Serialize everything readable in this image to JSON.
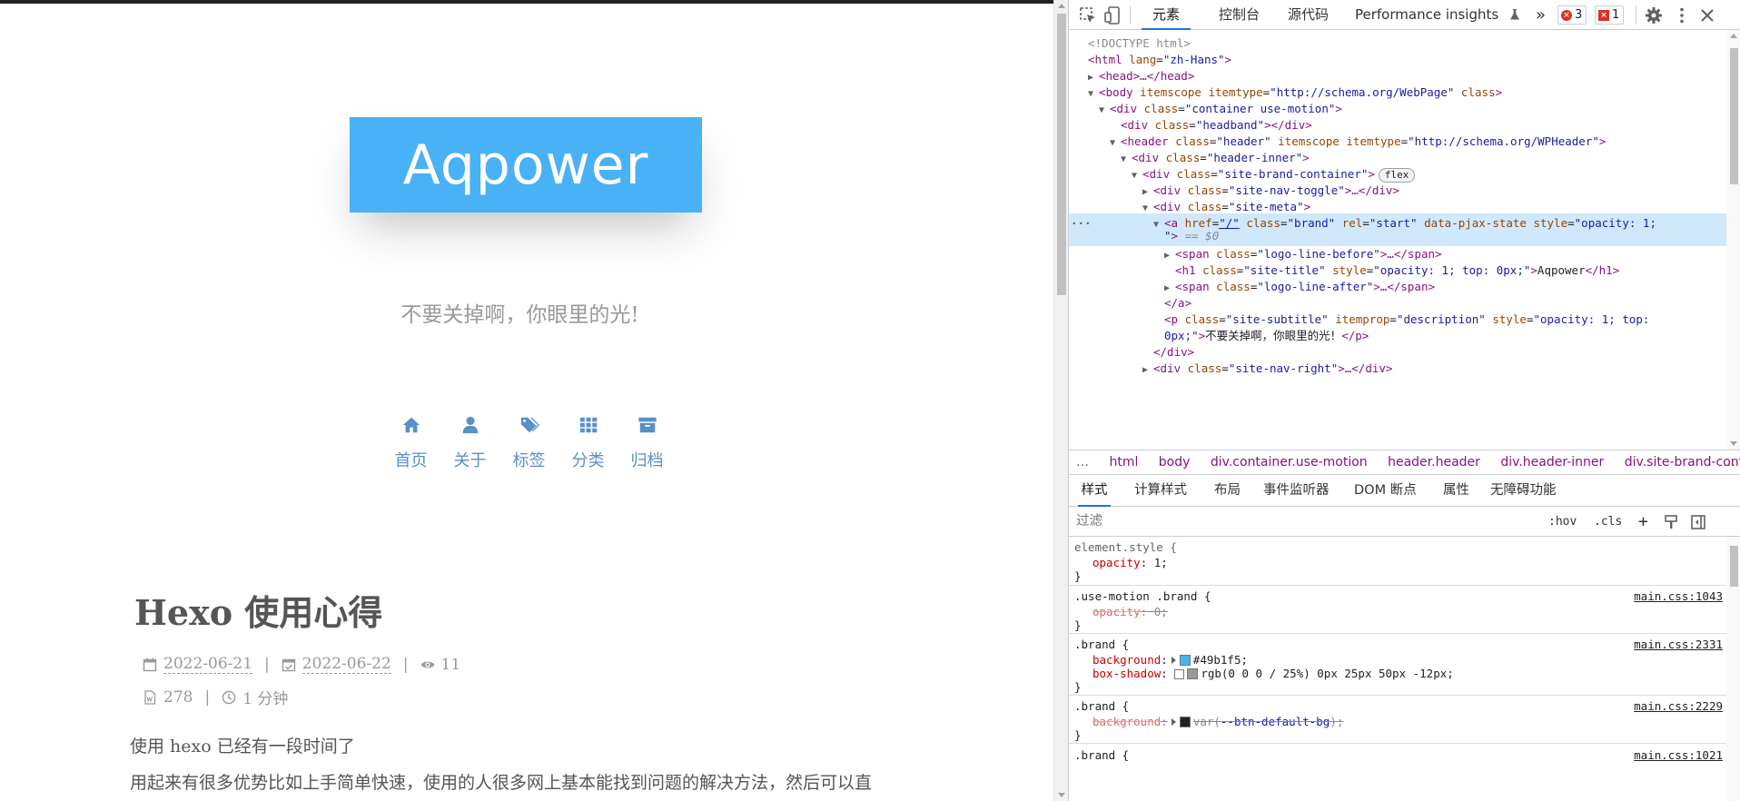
{
  "page": {
    "site_title": "Aqpower",
    "site_subtitle": "不要关掉啊，你眼里的光!",
    "nav": [
      {
        "icon": "home-icon",
        "label": "首页"
      },
      {
        "icon": "user-icon",
        "label": "关于"
      },
      {
        "icon": "tags-icon",
        "label": "标签"
      },
      {
        "icon": "grid-icon",
        "label": "分类"
      },
      {
        "icon": "archive-icon",
        "label": "归档"
      }
    ],
    "post": {
      "title": "Hexo 使用心得",
      "created": "2022-06-21",
      "updated": "2022-06-22",
      "views": "11",
      "words": "278",
      "read_time": "1 分钟",
      "separator": "|",
      "paragraph1": "使用 hexo 已经有一段时间了",
      "paragraph2": "用起来有很多优势比如上手简单快速，使用的人很多网上基本能找到问题的解决方法，然后可以直"
    },
    "colors": {
      "brand": "#49b1f5",
      "nav": "#5891c5"
    }
  },
  "devtools": {
    "tabs": [
      "元素",
      "控制台",
      "源代码",
      "Performance insights"
    ],
    "more": "»",
    "error_count": "3",
    "issue_count": "1",
    "dom": {
      "l1": "<!DOCTYPE html>",
      "l2_tag": "<html",
      "l2_attr": "lang",
      "l2_val": "\"zh-Hans\"",
      "l2_end": ">",
      "l3": "<head>…</head>",
      "l4_tag": "<body",
      "l4_a1": "itemscope",
      "l4_a2": "itemtype",
      "l4_v2": "\"http://schema.org/WebPage\"",
      "l4_a3": "class",
      "l4_end": ">",
      "l5_tag": "<div",
      "l5_a": "class",
      "l5_v": "\"container use-motion\"",
      "l5_end": ">",
      "l6_tag": "<div",
      "l6_a": "class",
      "l6_v": "\"headband\"",
      "l6_end": "></div>",
      "l7_tag": "<header",
      "l7_a1": "class",
      "l7_v1": "\"header\"",
      "l7_a2": "itemscope",
      "l7_a3": "itemtype",
      "l7_v3": "\"http://schema.org/WPHeader\"",
      "l7_end": ">",
      "l8_tag": "<div",
      "l8_a": "class",
      "l8_v": "\"header-inner\"",
      "l8_end": ">",
      "l9_tag": "<div",
      "l9_a": "class",
      "l9_v": "\"site-brand-container\"",
      "l9_end": ">",
      "l9_badge": "flex",
      "l10_tag": "<div",
      "l10_a": "class",
      "l10_v": "\"site-nav-toggle\"",
      "l10_end": ">…</div>",
      "l11_tag": "<div",
      "l11_a": "class",
      "l11_v": "\"site-meta\"",
      "l11_end": ">",
      "l12_tag": "<a",
      "l12_a1": "href",
      "l12_v1": "\"/\"",
      "l12_a2": "class",
      "l12_v2": "\"brand\"",
      "l12_a3": "rel",
      "l12_v3": "\"start\"",
      "l12_a4": "data-pjax-state",
      "l12_a5": "style",
      "l12_v5": "\"opacity: 1;",
      "l13_v": "\"",
      "l13_end": ">",
      "l13_eq": "== $0",
      "l14_tag": "<span",
      "l14_a": "class",
      "l14_v": "\"logo-line-before\"",
      "l14_end": ">…</span>",
      "l15_tag": "<h1",
      "l15_a1": "class",
      "l15_v1": "\"site-title\"",
      "l15_a2": "style",
      "l15_v2": "\"opacity: 1; top: 0px;\"",
      "l15_gt": ">",
      "l15_text": "Aqpower",
      "l15_close": "</h1>",
      "l16_tag": "<span",
      "l16_a": "class",
      "l16_v": "\"logo-line-after\"",
      "l16_end": ">…</span>",
      "l17": "</a>",
      "l18_tag": "<p",
      "l18_a1": "class",
      "l18_v1": "\"site-subtitle\"",
      "l18_a2": "itemprop",
      "l18_v2": "\"description\"",
      "l18_a3": "style",
      "l18_v3": "\"opacity: 1; top:",
      "l19_v": "0px;\"",
      "l19_gt": ">",
      "l19_text": "不要关掉啊，你眼里的光！",
      "l19_close": "</p>",
      "l20": "</div>",
      "l21_tag": "<div",
      "l21_a": "class",
      "l21_v": "\"site-nav-right\"",
      "l21_end": ">…</div>"
    },
    "breadcrumbs": [
      "…",
      "html",
      "body",
      "div.container.use-motion",
      "header.header",
      "div.header-inner",
      "div.site-brand-contai",
      "…"
    ],
    "subtabs": [
      "样式",
      "计算样式",
      "布局",
      "事件监听器",
      "DOM 断点",
      "属性",
      "无障碍功能"
    ],
    "filter_placeholder": "过滤",
    "filter_buttons": {
      "hov": ":hov",
      "cls": ".cls",
      "plus": "+"
    },
    "styles": {
      "r1_sel": "element.style {",
      "r1_p": "opacity",
      "r1_v": "1;",
      "r2_sel": ".use-motion .brand {",
      "r2_src": "main.css:1043",
      "r2_p": "opacity",
      "r2_v": "0;",
      "r3_sel": ".brand {",
      "r3_src": "main.css:2331",
      "r3_p1": "background",
      "r3_v1": "#49b1f5;",
      "r3_p2": "box-shadow",
      "r3_v2": "rgb(0 0 0 / 25%) 0px 25px 50px -12px;",
      "r4_sel": ".brand {",
      "r4_src": "main.css:2229",
      "r4_p": "background",
      "r4_v_pre": "var(",
      "r4_v_var": "--btn-default-bg",
      "r4_v_post": ");",
      "r5_sel": ".brand {",
      "r5_src": "main.css:1021",
      "close": "}"
    }
  }
}
